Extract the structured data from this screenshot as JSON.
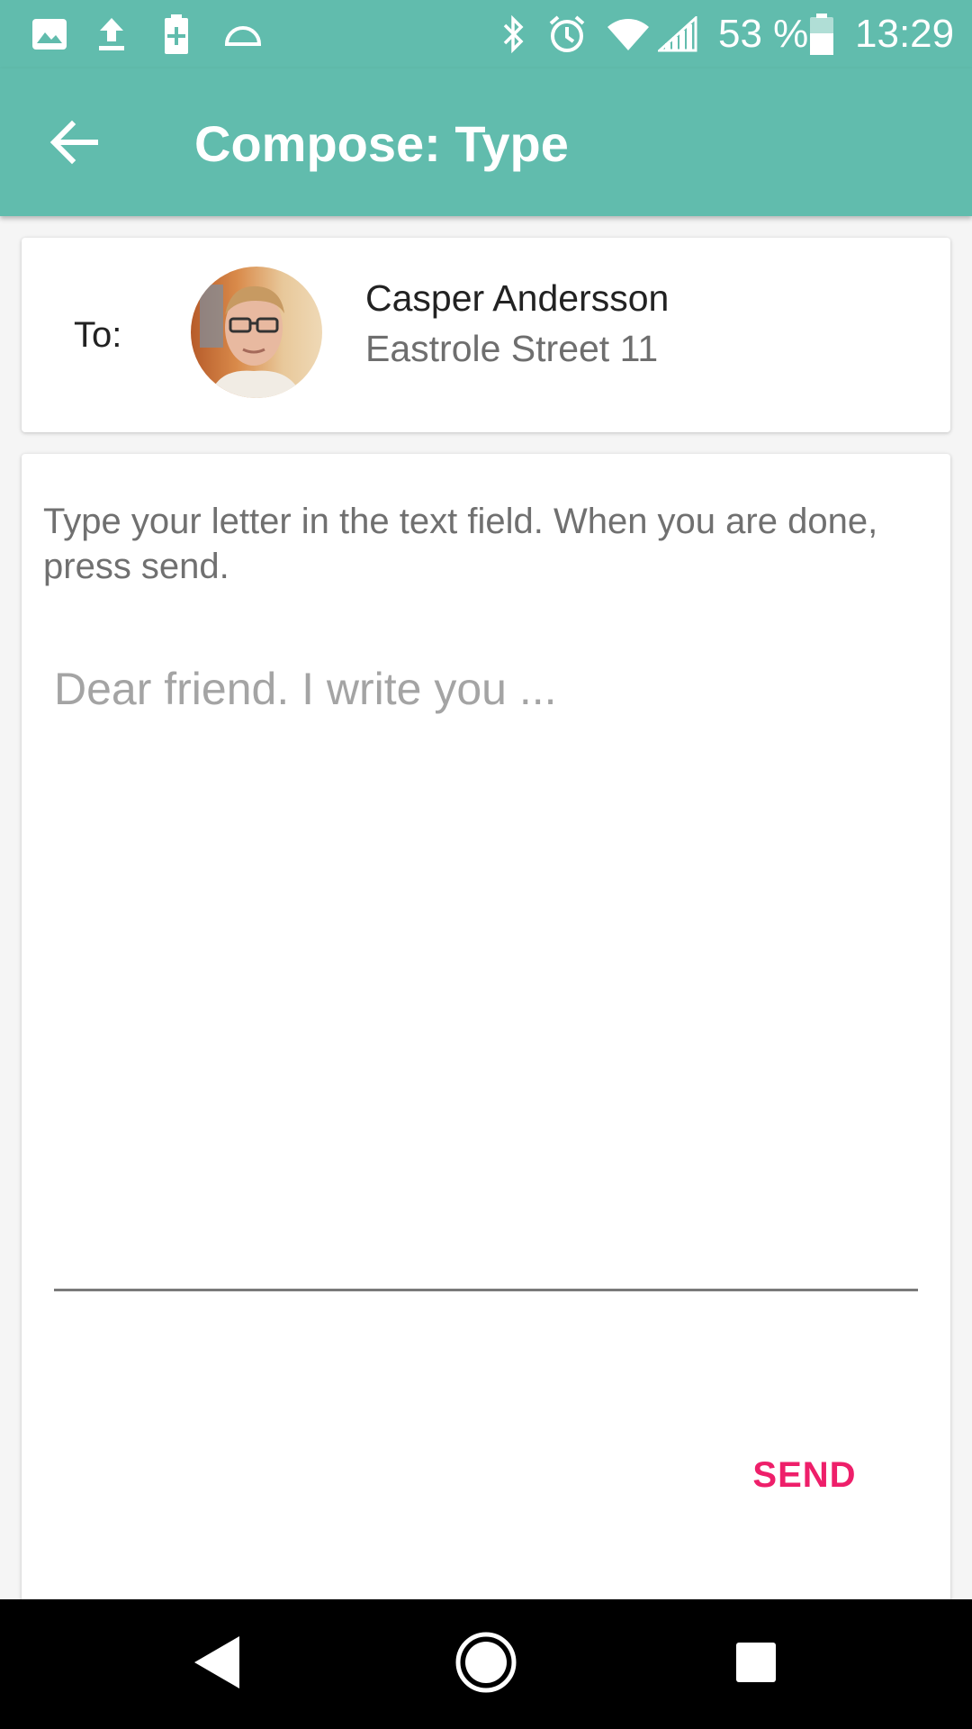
{
  "status_bar": {
    "icons": [
      "image-icon",
      "upload-icon",
      "battery-plus-icon",
      "dome-icon",
      "bluetooth-icon",
      "alarm-icon",
      "wifi-icon",
      "signal-icon",
      "battery-icon"
    ],
    "battery_text": "53 %",
    "time": "13:29"
  },
  "app_bar": {
    "back_icon": "arrow-back-icon",
    "title": "Compose: Type"
  },
  "recipient": {
    "label": "To:",
    "name": "Casper Andersson",
    "address": "Eastrole Street 11"
  },
  "letter": {
    "instructions": "Type your letter in the text field. When you are done, press send.",
    "input_value": "",
    "input_placeholder": "Dear friend. I write you ...",
    "send_label": "SEND"
  },
  "colors": {
    "primary": "#61bcad",
    "accent": "#ee1f6a"
  },
  "nav_bar": {
    "icons": [
      "nav-back-icon",
      "nav-home-icon",
      "nav-recents-icon"
    ]
  }
}
